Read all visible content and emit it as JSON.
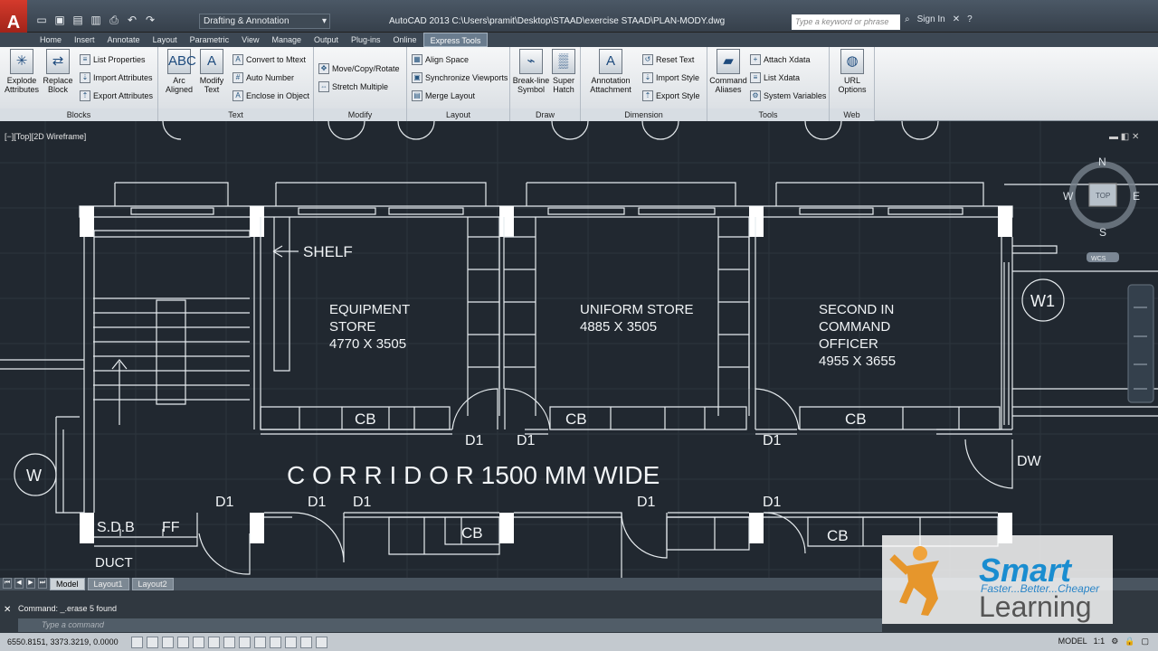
{
  "app": {
    "title": "AutoCAD 2013   C:\\Users\\pramit\\Desktop\\STAAD\\exercise STAAD\\PLAN-MODY.dwg",
    "workspace": "Drafting & Annotation",
    "search_placeholder": "Type a keyword or phrase",
    "sign_in": "Sign In"
  },
  "tabs": [
    "Home",
    "Insert",
    "Annotate",
    "Layout",
    "Parametric",
    "View",
    "Manage",
    "Output",
    "Plug-ins",
    "Online",
    "Express Tools"
  ],
  "active_tab": "Express Tools",
  "ribbon": {
    "blocks": {
      "title": "Blocks",
      "explode": "Explode\nAttributes",
      "replace": "Replace\nBlock",
      "list_props": "List Properties",
      "import_attrs": "Import Attributes",
      "export_attrs": "Export Attributes"
    },
    "text": {
      "title": "Text",
      "arc": "Arc\nAligned",
      "modify": "Modify\nText",
      "convert": "Convert to Mtext",
      "auto_number": "Auto Number",
      "enclose": "Enclose in Object"
    },
    "modify": {
      "title": "Modify",
      "move_copy": "Move/Copy/Rotate",
      "stretch": "Stretch Multiple"
    },
    "layout": {
      "title": "Layout",
      "align": "Align Space",
      "sync": "Synchronize Viewports",
      "merge": "Merge Layout"
    },
    "draw": {
      "title": "Draw",
      "breakline": "Break-line\nSymbol",
      "hatch": "Super\nHatch"
    },
    "dimension": {
      "title": "Dimension",
      "annotation": "Annotation\nAttachment",
      "reset": "Reset Text",
      "import_style": "Import Style",
      "export_style": "Export Style"
    },
    "tools": {
      "title": "Tools",
      "aliases": "Command\nAliases",
      "attach": "Attach Xdata",
      "list": "List Xdata",
      "sysvars": "System Variables"
    },
    "web": {
      "title": "Web",
      "url": "URL\nOptions"
    }
  },
  "viewport": {
    "label": "[−][Top][2D Wireframe]",
    "compass": {
      "n": "N",
      "e": "E",
      "s": "S",
      "w": "W",
      "top": "TOP",
      "wcs": "WCS"
    }
  },
  "plan": {
    "shelf": "SHELF",
    "room1": [
      "EQUIPMENT",
      "STORE",
      "4770 X 3505"
    ],
    "room2": [
      "UNIFORM STORE",
      "4885 X 3505"
    ],
    "room3": [
      "SECOND IN",
      "COMMAND",
      "OFFICER",
      "4955 X 3655"
    ],
    "corridor": "C O R R I D O R 1500 MM WIDE",
    "doors": [
      "D1",
      "D1",
      "D1",
      "D1",
      "D1",
      "D1",
      "D1",
      "D1"
    ],
    "windows": [
      "W1",
      "W"
    ],
    "dw": "DW",
    "cb": [
      "CB",
      "CB",
      "CB",
      "CB",
      "CB"
    ],
    "sdb": "S.D.B",
    "ff": "FF",
    "duct": "DUCT"
  },
  "layout_tabs": [
    "Model",
    "Layout1",
    "Layout2"
  ],
  "command": {
    "history": "Command:  _.erase 5 found",
    "prompt": "Type a command"
  },
  "status": {
    "coords": "6550.8151, 3373.3219, 0.0000",
    "model": "MODEL",
    "scale": "1:1"
  },
  "watermark": {
    "title": "Smart",
    "tagline": "Faster...Better...Cheaper",
    "subtitle": "Learning"
  }
}
